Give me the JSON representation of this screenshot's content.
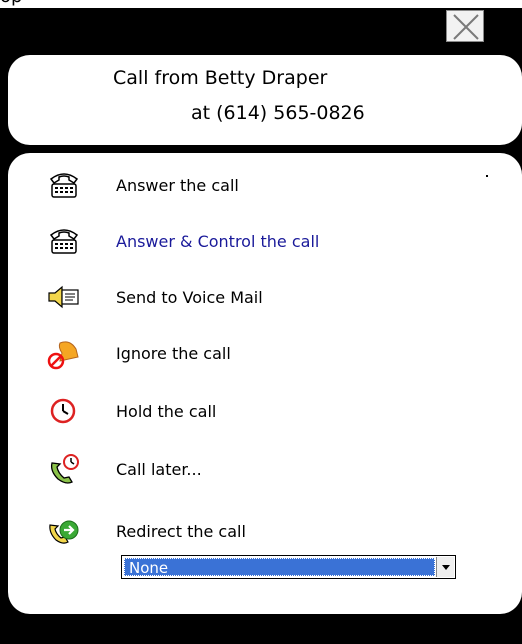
{
  "top_label": "op",
  "header": {
    "caller_line": "Call from Betty Draper",
    "number_line": "at (614) 565-0826"
  },
  "menu": {
    "items": [
      {
        "label": "Answer the call",
        "icon": "telephone-icon"
      },
      {
        "label": "Answer & Control the call",
        "icon": "telephone-control-icon"
      },
      {
        "label": "Send to Voice Mail",
        "icon": "voicemail-speaker-icon"
      },
      {
        "label": "Ignore the call",
        "icon": "ignore-bell-icon"
      },
      {
        "label": "Hold the call",
        "icon": "clock-hold-icon"
      },
      {
        "label": "Call later...",
        "icon": "phone-clock-icon"
      },
      {
        "label": "Redirect the call",
        "icon": "redirect-phone-icon"
      }
    ],
    "redirect_select": {
      "value": "None"
    }
  },
  "colors": {
    "frame": "#000000",
    "panel": "#ffffff",
    "link_blue": "#1a1a9a",
    "select_highlight": "#3a72d6"
  }
}
